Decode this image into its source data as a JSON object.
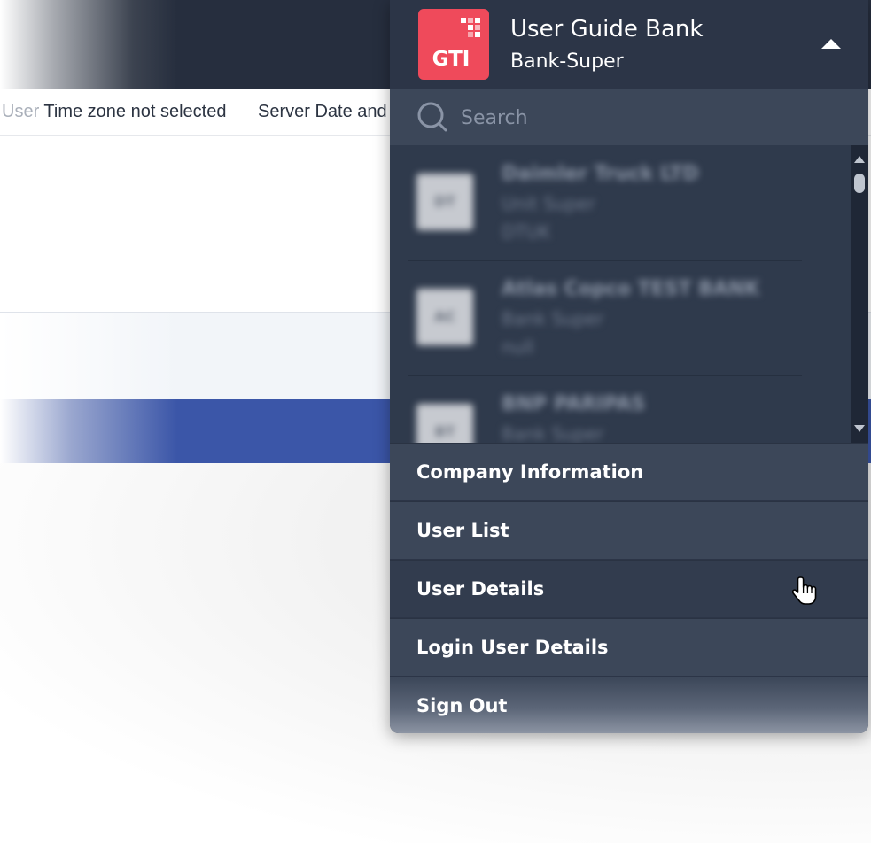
{
  "background": {
    "timezone_prefix": "User ",
    "timezone_text": "Time zone not selected",
    "server_date_text": "Server Date and"
  },
  "account": {
    "logo_text": "GTI",
    "logo_color": "#ef4a5b",
    "company_name": "User Guide Bank",
    "role": "Bank-Super",
    "collapse_icon": "caret-up-icon"
  },
  "search": {
    "placeholder": "Search",
    "icon": "search-icon"
  },
  "company_list": [
    {
      "avatar": "DT",
      "name": "Daimler Truck LTD",
      "role": "Unit Super",
      "code": "DTUK"
    },
    {
      "avatar": "AC",
      "name": "Atlas Copco TEST BANK",
      "role": "Bank Super",
      "code": "null"
    },
    {
      "avatar": "BT",
      "name": "BNP PARIPAS",
      "role": "Bank Super",
      "code": ""
    }
  ],
  "menu": [
    {
      "id": "company-information",
      "label": "Company Information"
    },
    {
      "id": "user-list",
      "label": "User List"
    },
    {
      "id": "user-details",
      "label": "User Details"
    },
    {
      "id": "login-user-details",
      "label": "Login User Details"
    },
    {
      "id": "sign-out",
      "label": "Sign Out"
    }
  ],
  "colors": {
    "panel_bg": "#2c3547",
    "menu_bg": "#3c4759",
    "accent_blue": "#3b56a8"
  }
}
